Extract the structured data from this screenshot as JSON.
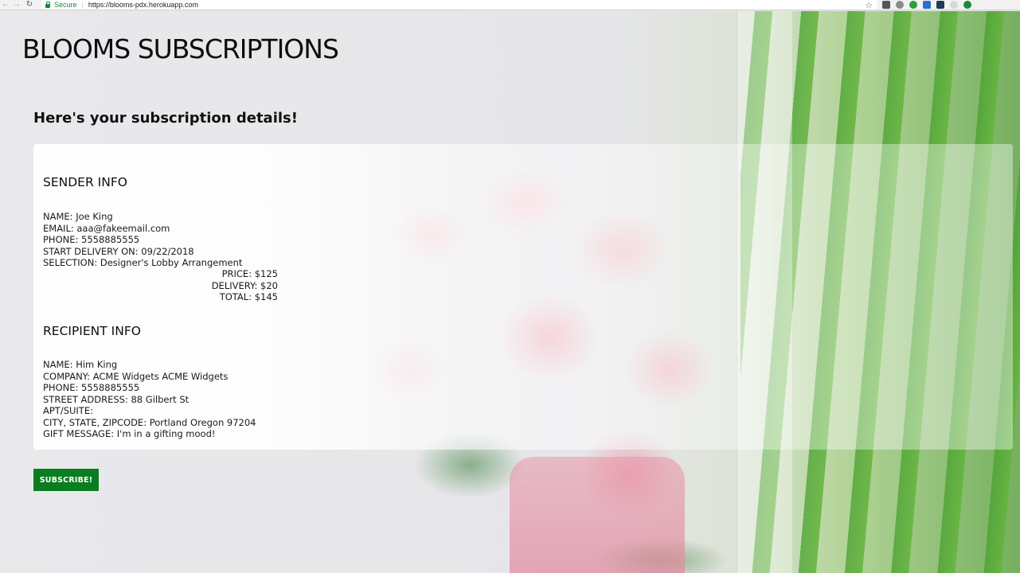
{
  "browser": {
    "secure_label": "Secure",
    "url": "https://blooms-pdx.herokuapp.com"
  },
  "page": {
    "title": "BLOOMS SUBSCRIPTIONS",
    "subtitle": "Here's your subscription details!"
  },
  "sender": {
    "heading": "SENDER INFO",
    "lines": [
      "NAME: Joe King",
      "EMAIL: aaa@fakeemail.com",
      "PHONE: 5558885555",
      "START DELIVERY ON: 09/22/2018",
      "SELECTION: Designer's Lobby Arrangement"
    ],
    "totals": [
      "PRICE: $125",
      "DELIVERY: $20",
      "TOTAL: $145"
    ]
  },
  "recipient": {
    "heading": "RECIPIENT INFO",
    "lines": [
      "NAME: Him King",
      "COMPANY: ACME Widgets ACME Widgets",
      "PHONE: 5558885555",
      "STREET ADDRESS: 88 Gilbert St",
      "APT/SUITE:",
      "CITY, STATE, ZIPCODE: Portland Oregon 97204",
      "GIFT MESSAGE: I'm in a gifting mood!"
    ]
  },
  "actions": {
    "subscribe_label": "SUBSCRIBE!"
  },
  "colors": {
    "subscribe_button": "#0a7d20",
    "secure_green": "#1a8a3a"
  }
}
